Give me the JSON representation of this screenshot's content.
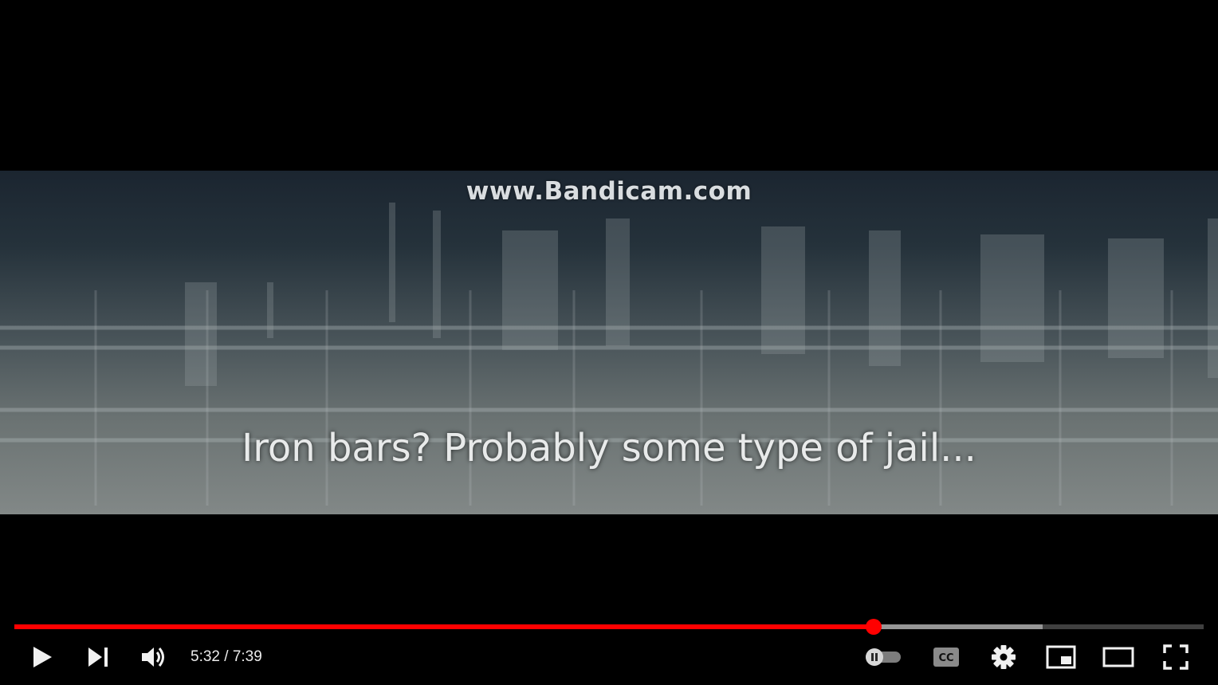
{
  "video": {
    "watermark": "www.Bandicam.com",
    "caption": "Iron bars? Probably some type of jail..."
  },
  "progress": {
    "played_fraction": 0.7226,
    "buffered_fraction": 0.8649,
    "played_color": "#ff0000"
  },
  "controls": {
    "current_time": "5:32",
    "separator": " / ",
    "duration": "7:39",
    "play_icon": "play-icon",
    "next_icon": "next-icon",
    "volume_icon": "volume-icon",
    "autoplay_icon": "autoplay-toggle-icon",
    "captions_icon": "cc-icon",
    "settings_icon": "gear-icon",
    "miniplayer_icon": "miniplayer-icon",
    "theater_icon": "theater-mode-icon",
    "fullscreen_icon": "fullscreen-icon"
  }
}
